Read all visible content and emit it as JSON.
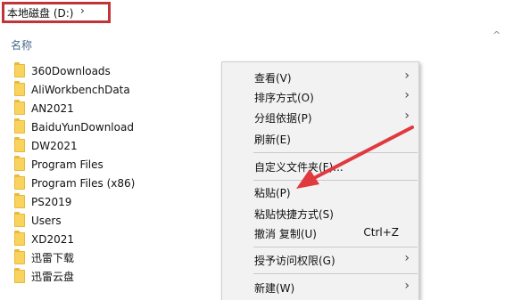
{
  "address_bar": {
    "path": "本地磁盘 (D:)",
    "chevron": "›"
  },
  "column_header": {
    "name_label": "名称",
    "sort_indicator": "^"
  },
  "files": [
    "360Downloads",
    "AliWorkbenchData",
    "AN2021",
    "BaiduYunDownload",
    "DW2021",
    "Program Files",
    "Program Files (x86)",
    "PS2019",
    "Users",
    "XD2021",
    "迅雷下载",
    "迅雷云盘"
  ],
  "context_menu": {
    "view": "查看(V)",
    "sort_by": "排序方式(O)",
    "group_by": "分组依据(P)",
    "refresh": "刷新(E)",
    "customize_folder": "自定义文件夹(F)...",
    "paste": "粘贴(P)",
    "paste_shortcut": "粘贴快捷方式(S)",
    "undo_copy": "撤消 复制(U)",
    "undo_shortcut": "Ctrl+Z",
    "grant_access": "授予访问权限(G)",
    "new": "新建(W)",
    "submenu_arrow": "›"
  },
  "colors": {
    "highlight_border": "#c0353a",
    "annotation_arrow": "#e0393e",
    "folder": "#f8d35e"
  }
}
